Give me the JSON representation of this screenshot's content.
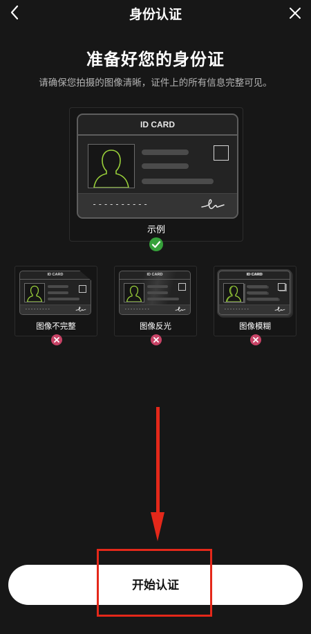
{
  "header": {
    "title": "身份认证",
    "back_icon": "chevron-left-icon",
    "close_icon": "close-icon"
  },
  "main": {
    "heading": "准备好您的身份证",
    "subtext": "请确保您拍摄的图像清晰，证件上的所有信息完整可见。"
  },
  "example": {
    "card_title": "ID CARD",
    "dashes": "----------",
    "label": "示例",
    "status_icon": "check-icon"
  },
  "bad_examples": [
    {
      "card_title": "ID CARD",
      "dashes": "---------",
      "label": "图像不完整",
      "status_icon": "x-icon"
    },
    {
      "card_title": "ID CARD",
      "dashes": "---------",
      "label": "图像反光",
      "status_icon": "x-icon"
    },
    {
      "card_title": "ID CARD",
      "dashes": "---------",
      "label": "图像模糊",
      "status_icon": "x-icon"
    }
  ],
  "actions": {
    "start_label": "开始认证"
  },
  "colors": {
    "background": "#171717",
    "accent_green": "#9ad13a",
    "success": "#35a13a",
    "error": "#c74366",
    "annotation_red": "#e4281a"
  }
}
